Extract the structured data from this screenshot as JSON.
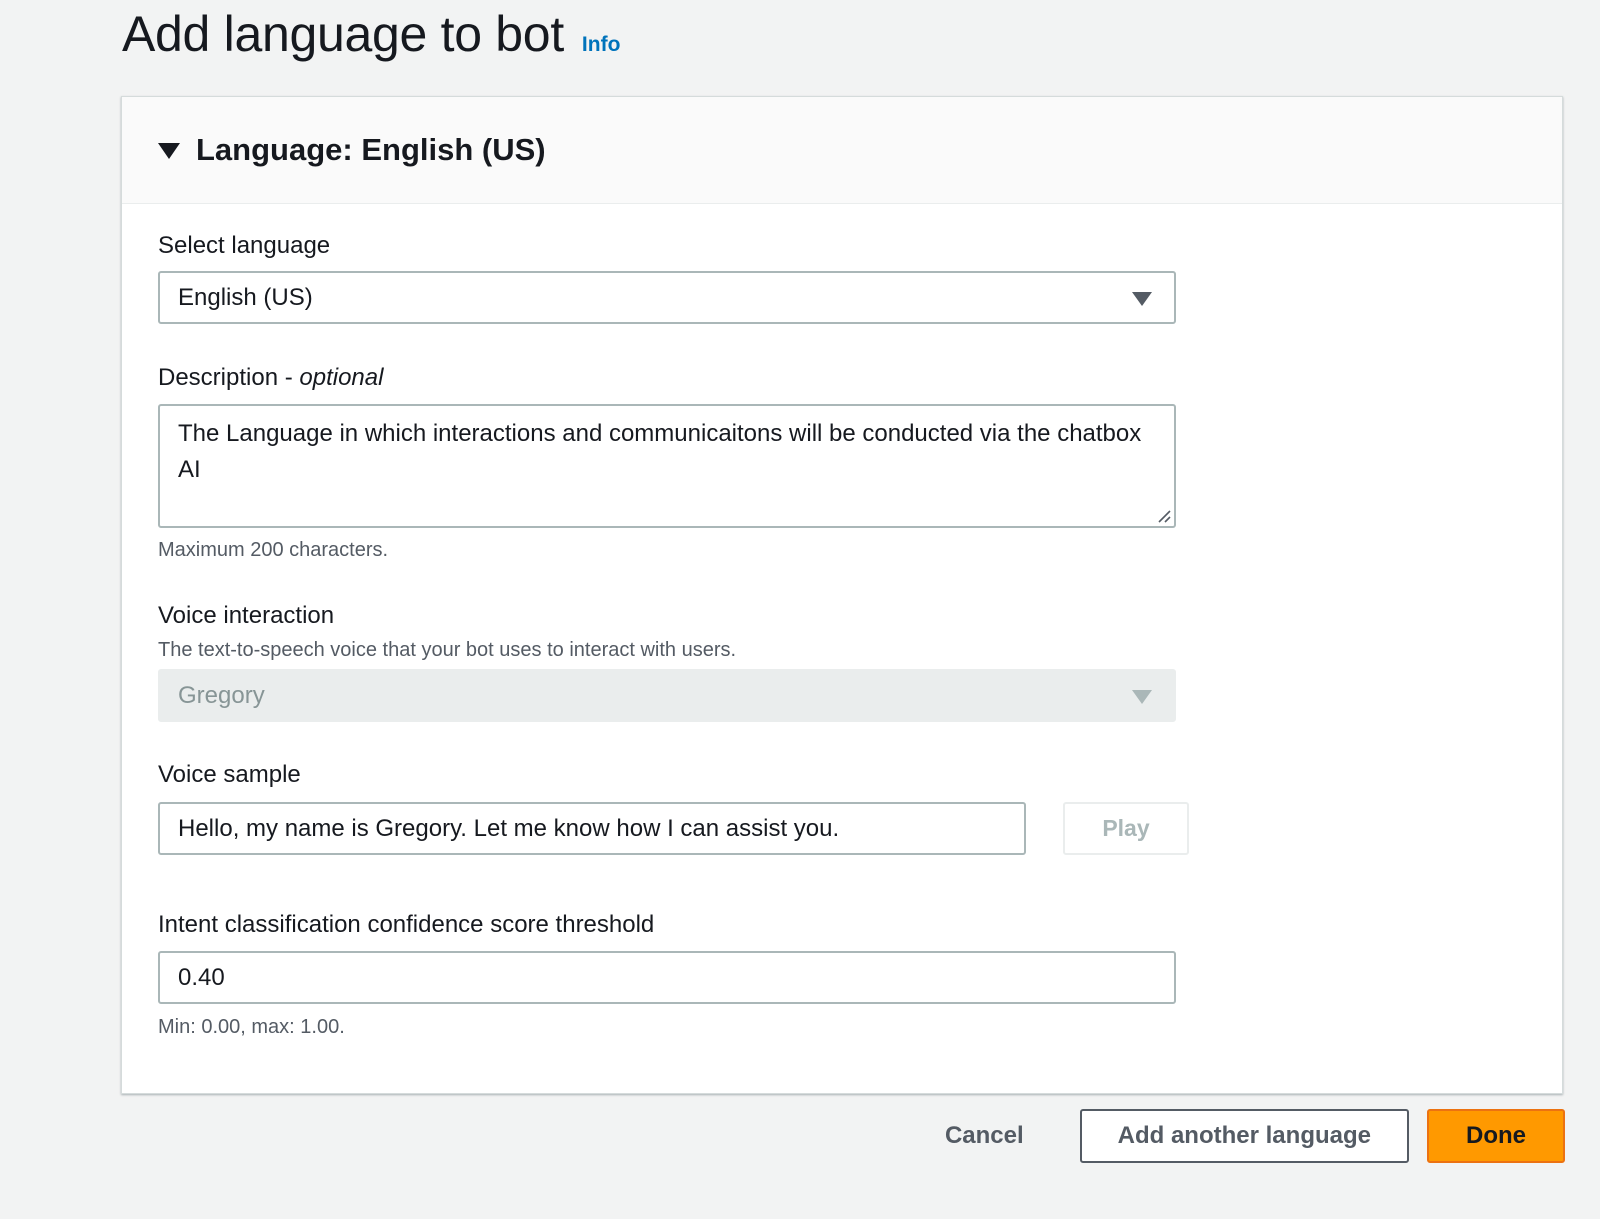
{
  "page": {
    "title": "Add language to bot",
    "info_link": "Info"
  },
  "panel": {
    "title": "Language: English (US)",
    "expanded": true
  },
  "form": {
    "select_language": {
      "label": "Select language",
      "value": "English (US)"
    },
    "description": {
      "label": "Description - ",
      "label_optional": "optional",
      "value": "The Language in which interactions and communicaitons will be conducted via the chatbox AI",
      "constraint": "Maximum 200 characters."
    },
    "voice_interaction": {
      "label": "Voice interaction",
      "description": "The text-to-speech voice that your bot uses to interact with users.",
      "value": "Gregory",
      "disabled": true
    },
    "voice_sample": {
      "label": "Voice sample",
      "value": "Hello, my name is Gregory. Let me know how I can assist you.",
      "play_label": "Play"
    },
    "confidence_threshold": {
      "label": "Intent classification confidence score threshold",
      "value": "0.40",
      "constraint": "Min: 0.00, max: 1.00."
    }
  },
  "actions": {
    "cancel_label": "Cancel",
    "add_another_label": "Add another language",
    "done_label": "Done"
  },
  "colors": {
    "primary_button": "#ff9900",
    "link": "#0073bb",
    "background": "#f2f3f3"
  }
}
